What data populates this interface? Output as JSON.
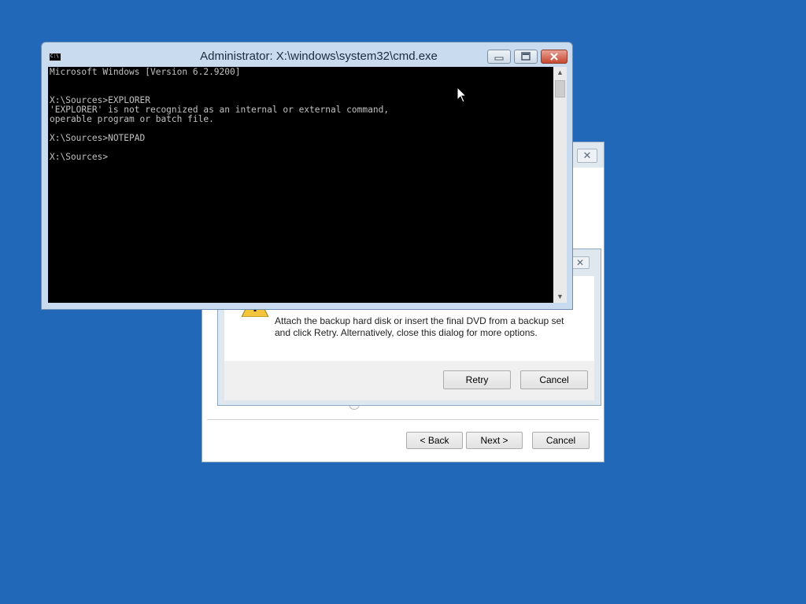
{
  "cmd_window": {
    "title": "Administrator: X:\\windows\\system32\\cmd.exe",
    "icon_label": "C:\\",
    "lines": [
      "Microsoft Windows [Version 6.2.9200]",
      "",
      "",
      "X:\\Sources>EXPLORER",
      "'EXPLORER' is not recognized as an internal or external command,",
      "operable program or batch file.",
      "",
      "X:\\Sources>NOTEPAD",
      "",
      "X:\\Sources>"
    ],
    "buttons": {
      "minimize_icon": "minimize-icon",
      "maximize_icon": "maximize-icon",
      "close_icon": "close-icon"
    }
  },
  "error_dialog": {
    "message": "Attach the backup hard disk or insert the final DVD from a backup set and click Retry. Alternatively, close this dialog for more options.",
    "retry_label": "Retry",
    "cancel_label": "Cancel",
    "icon": "warning-icon"
  },
  "wizard": {
    "back_label": "< Back",
    "next_label": "Next >",
    "cancel_label": "Cancel"
  },
  "colors": {
    "desktop": "#2169b8",
    "console_bg": "#000000",
    "console_text": "#c0c0c0",
    "close_button": "#c74a31"
  }
}
